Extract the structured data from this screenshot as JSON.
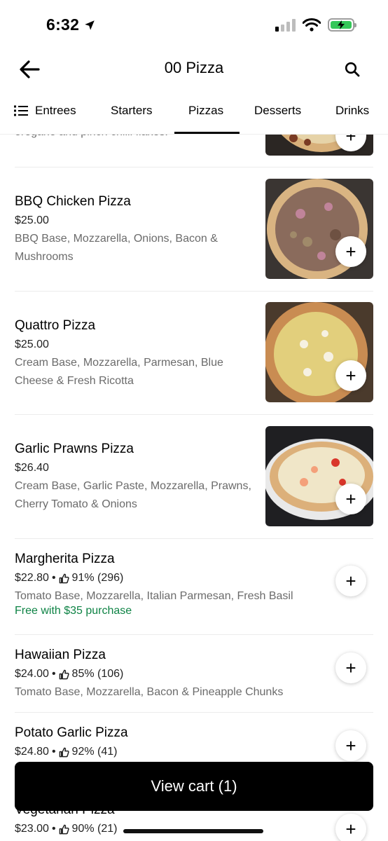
{
  "status_bar": {
    "time": "6:32"
  },
  "header": {
    "title": "00 Pizza"
  },
  "tabs": [
    {
      "label": "Entrees"
    },
    {
      "label": "Starters"
    },
    {
      "label": "Pizzas"
    },
    {
      "label": "Desserts"
    },
    {
      "label": "Drinks"
    }
  ],
  "active_tab": "Pizzas",
  "partial_item": {
    "desc_tail": "oregano and pinch chilli flakes."
  },
  "items": [
    {
      "name": "BBQ Chicken Pizza",
      "price": "$25.00",
      "description": "BBQ Base, Mozzarella, Onions, Bacon & Mushrooms",
      "add_label": "+"
    },
    {
      "name": "Quattro Pizza",
      "price": "$25.00",
      "description": "Cream Base, Mozzarella, Parmesan, Blue Cheese & Fresh Ricotta",
      "add_label": "+"
    },
    {
      "name": "Garlic Prawns Pizza",
      "price": "$26.40",
      "description": "Cream Base, Garlic Paste, Mozzarella, Prawns, Cherry Tomato & Onions",
      "add_label": "+"
    },
    {
      "name": "Margherita Pizza",
      "price": "$22.80",
      "rating": "91% (296)",
      "description": "Tomato Base, Mozzarella, Italian Parmesan, Fresh Basil",
      "promo": "Free with $35 purchase",
      "add_label": "+"
    },
    {
      "name": "Hawaiian Pizza",
      "price": "$24.00",
      "rating": "85% (106)",
      "description": "Tomato Base, Mozzarella, Bacon & Pineapple Chunks",
      "add_label": "+"
    },
    {
      "name": "Potato Garlic Pizza",
      "price": "$24.80",
      "rating": "92% (41)",
      "add_label": "+"
    },
    {
      "name": "Vegetarian Pizza",
      "price": "$23.00",
      "rating": "90% (21)",
      "add_label": "+"
    }
  ],
  "separator": "•",
  "cart": {
    "label": "View cart (1)"
  },
  "colors": {
    "promo": "#0e8345",
    "cart_bg": "#000000",
    "battery": "#35c759"
  }
}
